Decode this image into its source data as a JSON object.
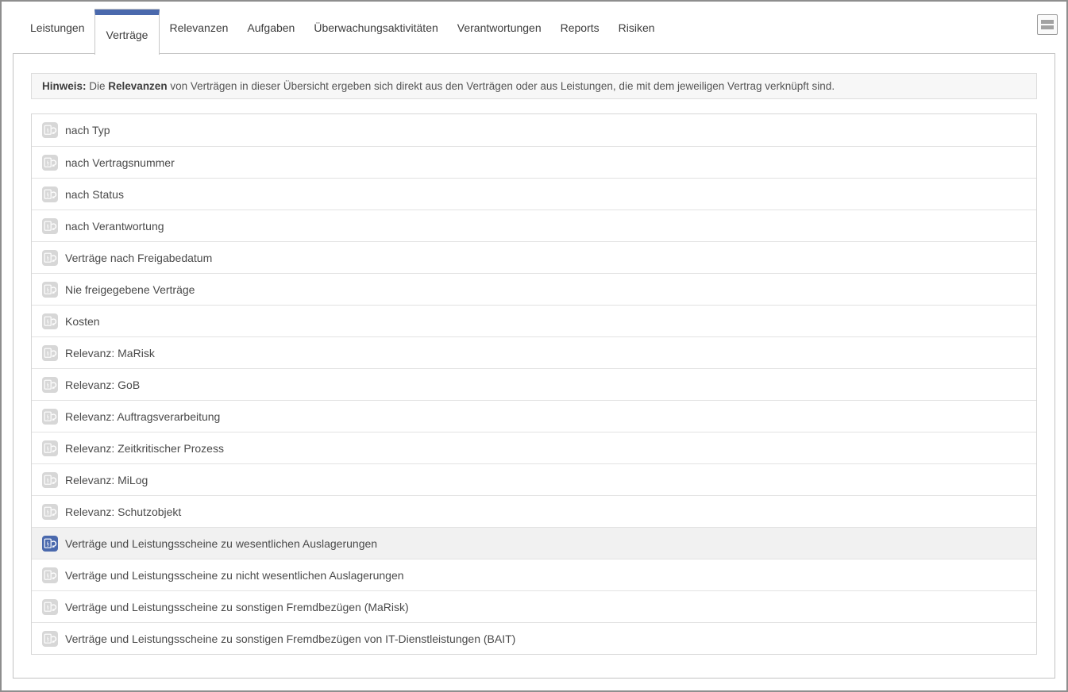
{
  "colors": {
    "accent": "#4a69ad",
    "frame": "#8e8e8e",
    "panel_border": "#c2c2c2",
    "hint_bg": "#f7f7f7",
    "hint_border": "#dddddd",
    "list_border": "#d6d6d6",
    "row_divider": "#e2e2e2",
    "selected_row_bg": "#f1f1f1",
    "icon_gray": "#d7d7d7",
    "row_text": "#4a4a4a",
    "tab_text": "#3d3d3d"
  },
  "tabs": [
    {
      "label": "Leistungen",
      "active": false
    },
    {
      "label": "Verträge",
      "active": true
    },
    {
      "label": "Relevanzen",
      "active": false
    },
    {
      "label": "Aufgaben",
      "active": false
    },
    {
      "label": "Überwachungsaktivitäten",
      "active": false
    },
    {
      "label": "Verantwortungen",
      "active": false
    },
    {
      "label": "Reports",
      "active": false
    },
    {
      "label": "Risiken",
      "active": false
    }
  ],
  "toolbar": {
    "menu_icon": "list-toggle-icon"
  },
  "hint": {
    "parts": [
      {
        "text": "Hinweis:",
        "bold": true
      },
      {
        "text": " Die ",
        "bold": false
      },
      {
        "text": "Relevanzen",
        "bold": true
      },
      {
        "text": " von Verträgen in dieser Übersicht ergeben sich direkt aus den Verträgen oder aus Leistungen, die mit dem jeweiligen Vertrag verknüpft sind.",
        "bold": false
      }
    ]
  },
  "reports": {
    "icon": "contract-report-icon",
    "items": [
      {
        "label": "nach Typ",
        "selected": false
      },
      {
        "label": "nach Vertragsnummer",
        "selected": false
      },
      {
        "label": "nach Status",
        "selected": false
      },
      {
        "label": "nach Verantwortung",
        "selected": false
      },
      {
        "label": "Verträge nach Freigabedatum",
        "selected": false
      },
      {
        "label": "Nie freigegebene Verträge",
        "selected": false
      },
      {
        "label": "Kosten",
        "selected": false
      },
      {
        "label": "Relevanz: MaRisk",
        "selected": false
      },
      {
        "label": "Relevanz: GoB",
        "selected": false
      },
      {
        "label": "Relevanz: Auftragsverarbeitung",
        "selected": false
      },
      {
        "label": "Relevanz: Zeitkritischer Prozess",
        "selected": false
      },
      {
        "label": "Relevanz: MiLog",
        "selected": false
      },
      {
        "label": "Relevanz: Schutzobjekt",
        "selected": false
      },
      {
        "label": "Verträge und Leistungsscheine zu wesentlichen Auslagerungen",
        "selected": true
      },
      {
        "label": "Verträge und Leistungsscheine zu nicht wesentlichen Auslagerungen",
        "selected": false
      },
      {
        "label": "Verträge und Leistungsscheine zu sonstigen Fremdbezügen (MaRisk)",
        "selected": false
      },
      {
        "label": "Verträge und Leistungsscheine zu sonstigen Fremdbezügen von IT-Dienstleistungen (BAIT)",
        "selected": false
      }
    ]
  }
}
